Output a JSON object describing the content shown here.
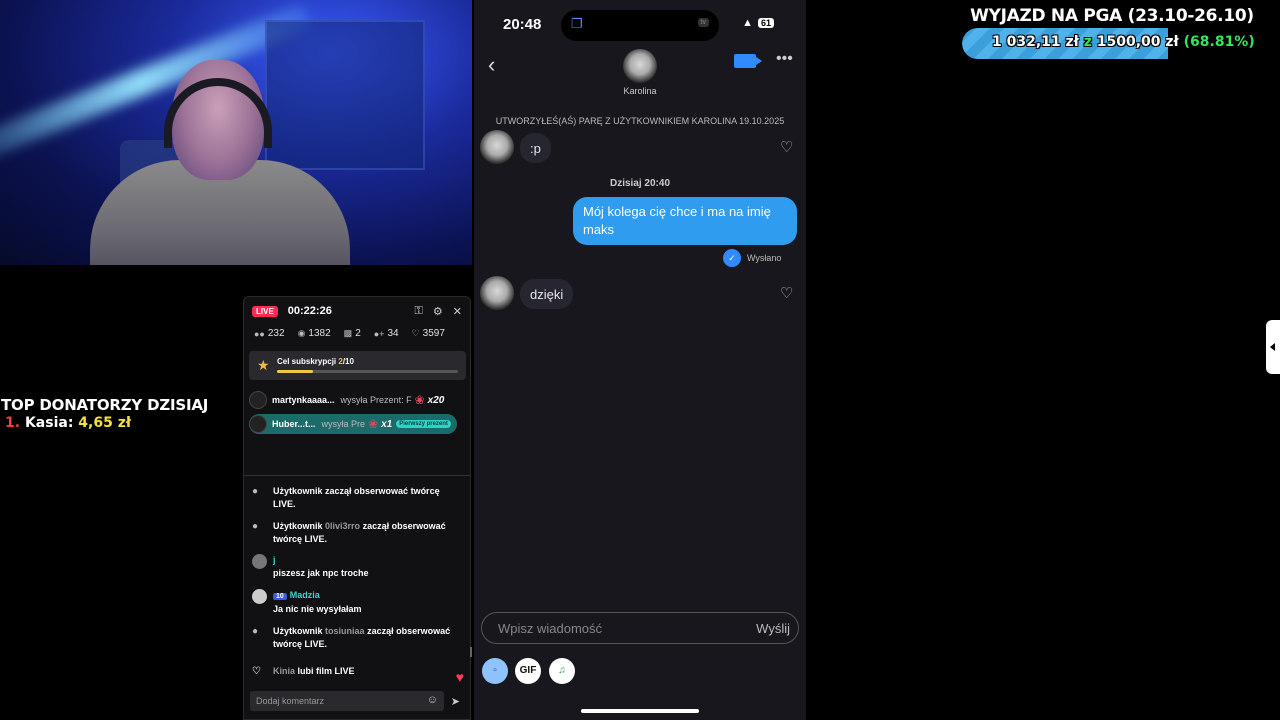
{
  "overlay": {
    "goal_title": "WYJAZD NA PGA (23.10-26.10)",
    "goal_current": "1 032,11 zł",
    "goal_separator": "z",
    "goal_target": "1500,00 zł",
    "goal_percent": "(68.81%)",
    "goal_progress_fraction": 0.6881,
    "donors_title": "TOP DONATORZY DZISIAJ",
    "donors": [
      {
        "rank": "1.",
        "name": "Kasia:",
        "amount": "4,65 zł"
      }
    ]
  },
  "live_panel": {
    "badge": "LIVE",
    "timer": "00:22:26",
    "stats": {
      "viewers": "232",
      "views": "1382",
      "gifts": "2",
      "followers": "34",
      "likes": "3597"
    },
    "sub_goal_label": "Cel subskrypcji",
    "sub_goal_current": "2",
    "sub_goal_total": "/10",
    "sub_goal_progress": 0.2,
    "gifts": [
      {
        "user": "martynkaaaa...",
        "action": "wysyła Prezent: F",
        "count": "x20"
      },
      {
        "user": "Huber...t...",
        "action": "wysyła Pre",
        "count": "x1",
        "badge": "Pierwszy prezent"
      }
    ],
    "chat": [
      {
        "user": "Użytkownik",
        "handle": "",
        "text": "zaczął obserwować twórcę LIVE."
      },
      {
        "user": "Użytkownik",
        "handle": "0livi3rro",
        "text": "zaczął obserwować twórcę LIVE."
      },
      {
        "user": "j",
        "text": "piszesz jak npc troche"
      },
      {
        "level": "10",
        "user": "Madzia",
        "text": "Ja nic nie wysyłałam"
      },
      {
        "user": "Użytkownik",
        "handle": "tosiuniaa",
        "text": "zaczął obserwować twórcę LIVE."
      },
      {
        "user": "Kinia",
        "text": "lubi film LIVE"
      }
    ],
    "comment_placeholder": "Dodaj komentarz"
  },
  "phone": {
    "status_time": "20:48",
    "island_badge": "tv",
    "battery": "61",
    "contact_name": "Karolina",
    "pair_note": "UTWORZYŁEŚ(AŚ) PARĘ Z UŻYTKOWNIKIEM KAROLINA 19.10.2025",
    "messages_in": [
      ":p",
      "dzięki"
    ],
    "date_separator": "Dzisiaj 20:40",
    "message_out": "Mój kolega cię chce i ma na imię maks",
    "sent_label": "Wysłano",
    "compose_placeholder": "Wpisz wiadomość",
    "send_label": "Wyślij",
    "tools": [
      "GIF"
    ]
  }
}
